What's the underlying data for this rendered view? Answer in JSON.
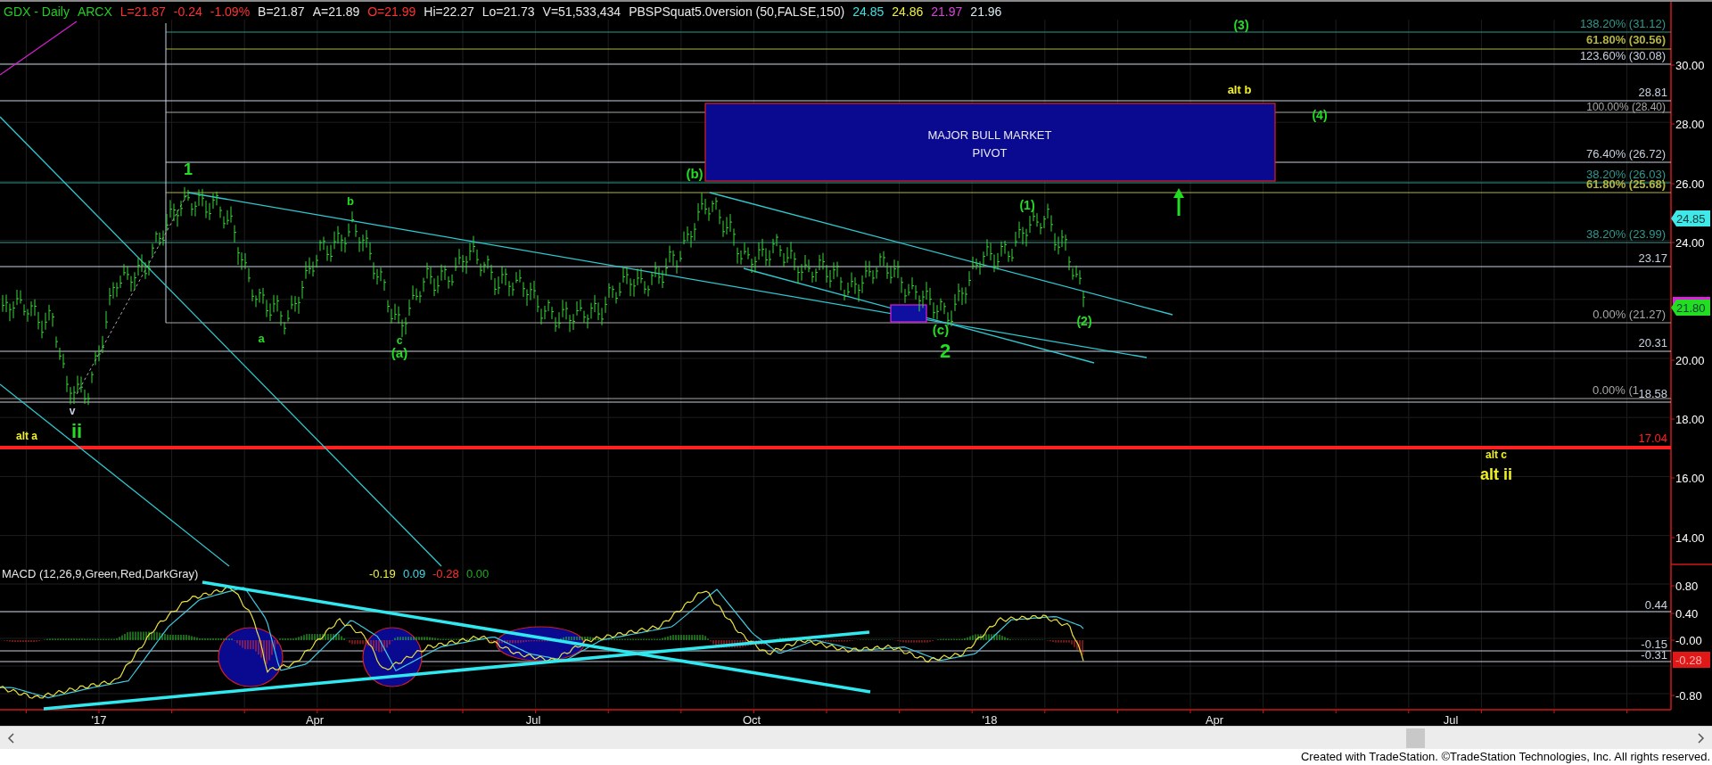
{
  "header": {
    "fields": [
      {
        "text": "GDX - Daily",
        "color": "#22cc22"
      },
      {
        "text": "ARCX",
        "color": "#22cc22"
      },
      {
        "text": "L=21.87",
        "color": "#ff3030"
      },
      {
        "text": "-0.24",
        "color": "#ff3030"
      },
      {
        "text": "-1.09%",
        "color": "#ff3030"
      },
      {
        "text": "B=21.87",
        "color": "#e8e8e8"
      },
      {
        "text": "A=21.89",
        "color": "#e8e8e8"
      },
      {
        "text": "O=21.99",
        "color": "#ff3030"
      },
      {
        "text": "Hi=22.27",
        "color": "#e8e8e8"
      },
      {
        "text": "Lo=21.73",
        "color": "#e8e8e8"
      },
      {
        "text": "V=51,533,434",
        "color": "#e8e8e8"
      },
      {
        "text": "PBSPSquat5.0version (50,FALSE,150)",
        "color": "#e8e8e8"
      },
      {
        "text": "24.85",
        "color": "#40e0e0"
      },
      {
        "text": "24.86",
        "color": "#f0f040"
      },
      {
        "text": "21.97",
        "color": "#e040e0"
      },
      {
        "text": "21.96",
        "color": "#d8e8f0"
      }
    ]
  },
  "price_axis": {
    "labels": [
      "30.00",
      "28.00",
      "26.00",
      "24.00",
      "20.00",
      "18.00",
      "16.00",
      "14.00"
    ],
    "markers": [
      {
        "text": "24.85",
        "color": "#40e8e8"
      },
      {
        "text": "21.80",
        "color": "#22dd22"
      }
    ]
  },
  "levels": [
    {
      "label": "138.20% (31.12)",
      "color": "#2e9a8e"
    },
    {
      "label": "61.80% (30.56)",
      "color": "#b4b440"
    },
    {
      "label": "123.60% (30.08)",
      "color": "#c8d0e0"
    },
    {
      "label": "28.81",
      "color": "#c8d0e0"
    },
    {
      "label": "100.00% (28.40)",
      "color": "#a8a8a8"
    },
    {
      "label": "76.40% (26.72)",
      "color": "#c8d0e0"
    },
    {
      "label": "38.20% (26.03)",
      "color": "#2e9a8e"
    },
    {
      "label": "61.80% (25.68)",
      "color": "#b4b440"
    },
    {
      "label": "38.20% (23.99)",
      "color": "#2e9a8e"
    },
    {
      "label": "23.17",
      "color": "#c8d0e0"
    },
    {
      "label": "0.00% (21.27)",
      "color": "#a8a8a8"
    },
    {
      "label": "20.31",
      "color": "#c8d0e0"
    },
    {
      "label": "0.00% (1",
      "color": "#a8a8a8"
    },
    {
      "label": "18.58",
      "color": "#c8d0e0"
    },
    {
      "label": "17.04",
      "color": "#ff2020"
    }
  ],
  "wave_labels": [
    {
      "text": "1",
      "color": "#22dd22"
    },
    {
      "text": "b",
      "color": "#22dd22"
    },
    {
      "text": "a",
      "color": "#22dd22"
    },
    {
      "text": "c",
      "color": "#22dd22"
    },
    {
      "text": "(a)",
      "color": "#22dd22"
    },
    {
      "text": "(b)",
      "color": "#22dd22"
    },
    {
      "text": "(c)",
      "color": "#22dd22"
    },
    {
      "text": "2",
      "color": "#22dd22"
    },
    {
      "text": "(1)",
      "color": "#22dd22"
    },
    {
      "text": "(2)",
      "color": "#22dd22"
    },
    {
      "text": "v",
      "color": "#c8d0e0"
    },
    {
      "text": "alt a",
      "color": "#f0f020"
    },
    {
      "text": "ii",
      "color": "#22dd22"
    },
    {
      "text": "(3)",
      "color": "#22dd22"
    },
    {
      "text": "alt b",
      "color": "#f0f020"
    },
    {
      "text": "(4)",
      "color": "#22dd22"
    },
    {
      "text": "alt c",
      "color": "#f0f020"
    },
    {
      "text": "alt ii",
      "color": "#f0f020"
    }
  ],
  "pivot_box": {
    "lines": [
      "MAJOR BULL MARKET",
      "PIVOT"
    ]
  },
  "macd": {
    "title": "MACD (12,26,9,Green,Red,DarkGray)",
    "values": [
      {
        "text": "-0.19",
        "color": "#f0f040"
      },
      {
        "text": "0.09",
        "color": "#40d8e8"
      },
      {
        "text": "-0.28",
        "color": "#ff3030"
      },
      {
        "text": "0.00",
        "color": "#22aa22"
      }
    ],
    "levels": [
      "0.44",
      "-0.15",
      "-0.31"
    ],
    "axis_labels": [
      "0.80",
      "0.40",
      "-0.00",
      "-0.80"
    ],
    "marker": {
      "text": "-0.28",
      "color": "#e01818"
    }
  },
  "time_axis": {
    "labels": [
      "'17",
      "Apr",
      "Jul",
      "Oct",
      "'18",
      "Apr",
      "Jul"
    ]
  },
  "footer": "Created with TradeStation. ©TradeStation Technologies, Inc. All rights reserved."
}
